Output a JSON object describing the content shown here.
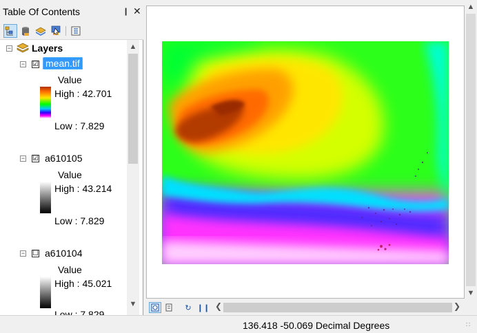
{
  "toc": {
    "title": "Table Of Contents",
    "root_label": "Layers",
    "layers": [
      {
        "name": "mean.tif",
        "checked": "☑",
        "value_label": "Value",
        "high": "High : 42.701",
        "low": "Low : 7.829"
      },
      {
        "name": "a610105",
        "checked": "☑",
        "value_label": "Value",
        "high": "High : 43.214",
        "low": "Low : 7.829"
      },
      {
        "name": "a610104",
        "checked": "☐",
        "value_label": "Value",
        "high": "High : 45.021",
        "low": "Low : 7.829"
      }
    ]
  },
  "status": {
    "coordinates": "136.418  -50.069 Decimal Degrees"
  },
  "colors": {
    "selection": "#3399ff",
    "ramp_colors": [
      "#ff0000",
      "#ffff00",
      "#00ff00",
      "#00ffff",
      "#0000ff",
      "#ff00ff",
      "#ffffff"
    ]
  }
}
